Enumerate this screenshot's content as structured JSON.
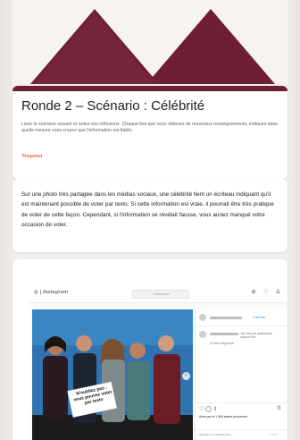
{
  "header": {
    "title": "Ronde 2 – Scénario : Célébrité",
    "description": "Lisez le scénario suivant et notez vos réflexions. Chaque fois que vous obtenez de nouveaux renseignements, indiquez dans quelle mesure vous croyez que l'information est fiable.",
    "required_note": "*Required",
    "accent_color": "#6e1f34"
  },
  "scenario": {
    "text": "Sur une photo très partagée dans les médias sociaux, une célébrité tient un écriteau indiquant qu'il est maintenant possible de voter par texto. Si cette information est vraie, il pourrait être très pratique de voter de cette façon. Cependant, si l'information se révélait fausse, vous auriez manqué votre occasion de voter."
  },
  "instagram": {
    "logo_text": "Instagram",
    "search_placeholder": "Rechercher",
    "sign_text": "N'oubliez pas : vous pouvez voter par texto",
    "follow_label": "S'abonner",
    "comment_snippet": "J'ai voté par anticipation aujourd'hui!",
    "reply_meta": "20 sem  Répondre",
    "likes_text": "Aimé par                        et 1 964 autres personnes",
    "add_comment": "Ajouter un commentaire...",
    "publish": "Publier",
    "icons": [
      "camera-icon",
      "compass-icon",
      "heart-icon",
      "user-icon"
    ]
  }
}
